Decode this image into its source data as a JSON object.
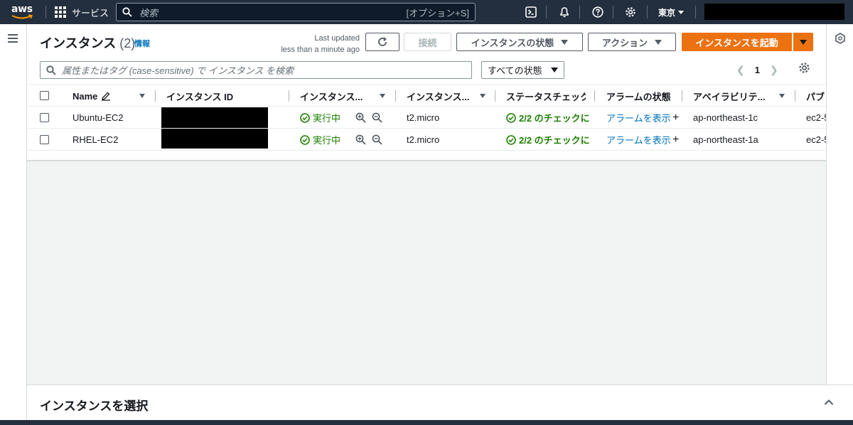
{
  "topnav": {
    "logo_text": "aws",
    "services_label": "サービス",
    "search_placeholder": "検索",
    "search_shortcut": "[オプション+S]",
    "region": "東京",
    "icons": [
      "cloudshell-icon",
      "notifications-icon",
      "help-icon",
      "settings-icon"
    ]
  },
  "panel": {
    "title": "インスタンス",
    "count": "(2)",
    "info_link": "情報",
    "last_updated_line1": "Last updated",
    "last_updated_line2": "less than a minute ago",
    "connect_label": "接続",
    "instance_state_label": "インスタンスの状態",
    "actions_label": "アクション",
    "launch_label": "インスタンスを起動",
    "filter_placeholder": "属性またはタグ (case-sensitive) で インスタンス を検索",
    "state_filter": "すべての状態",
    "page_number": "1"
  },
  "table": {
    "columns": [
      {
        "label": "Name"
      },
      {
        "label": "インスタンス ID"
      },
      {
        "label": "インスタンス..."
      },
      {
        "label": "インスタンス..."
      },
      {
        "label": "ステータスチェック"
      },
      {
        "label": "アラームの状態"
      },
      {
        "label": "アベイラビリテ..."
      },
      {
        "label": "パブ"
      }
    ],
    "rows": [
      {
        "name": "Ubuntu-EC2",
        "state": "実行中",
        "type": "t2.micro",
        "status_check": "2/2 のチェックに",
        "alarm": "アラームを表示",
        "az": "ap-northeast-1c",
        "public": "ec2-5"
      },
      {
        "name": "RHEL-EC2",
        "state": "実行中",
        "type": "t2.micro",
        "status_check": "2/2 のチェックに",
        "alarm": "アラームを表示",
        "az": "ap-northeast-1a",
        "public": "ec2-5"
      }
    ]
  },
  "bottom": {
    "title": "インスタンスを選択"
  },
  "colors": {
    "nav_bg": "#232f3e",
    "primary": "#ec7211",
    "link": "#0073bb",
    "success": "#1d8102"
  }
}
